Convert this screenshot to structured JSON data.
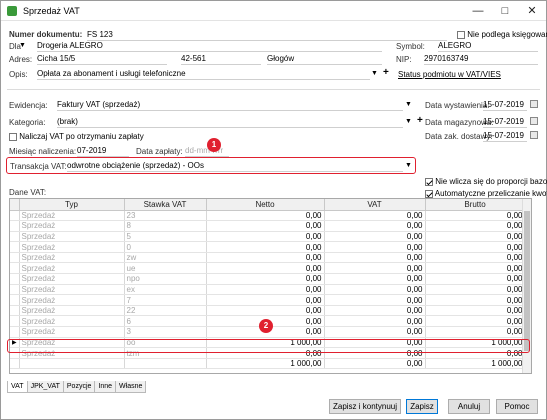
{
  "window": {
    "title": "Sprzedaż VAT"
  },
  "doc": {
    "number_label": "Numer dokumentu:",
    "number": "FS 123",
    "not_posted_label": "Nie podlega księgowaniu",
    "dla_label": "Dla",
    "customer": "Drogeria ALEGRO",
    "symbol_label": "Symbol:",
    "symbol": "ALEGRO",
    "address_label": "Adres:",
    "street": "Cicha 15/5",
    "postal": "42-561",
    "city": "Głogów",
    "nip_label": "NIP:",
    "nip": "2970163749",
    "desc_label": "Opis:",
    "desc": "Opłata za abonament i usługi telefoniczne",
    "vat_status_link": "Status podmiotu w VAT/VIES"
  },
  "meta": {
    "ewidencja_label": "Ewidencja:",
    "ewidencja": "Faktury VAT (sprzedaż)",
    "kategoria_label": "Kategoria:",
    "kategoria": "(brak)",
    "naliczaj_label": "Naliczaj VAT po otrzymaniu zapłaty",
    "miesiac_label": "Miesiąc naliczenia:",
    "miesiac": "07-2019",
    "data_zaplaty_label": "Data zapłaty:",
    "data_zaplaty_placeholder": "dd-mm-rrrr",
    "wystawienia_label": "Data wystawienia:",
    "wystawienia": "15-07-2019",
    "magazynowa_label": "Data magazynowa:",
    "magazynowa": "15-07-2019",
    "dostawy_label": "Data zak. dostawy:",
    "dostawy": "15-07-2019",
    "transakcja_label": "Transakcja VAT:",
    "transakcja": "odwrotne obciążenie (sprzedaż) - OOs",
    "dane_vat_label": "Dane VAT:",
    "nie_wlicza_label": "Nie wlicza się do proporcji bazowej",
    "auto_label": "Automatyczne przeliczanie kwot"
  },
  "table": {
    "headers": [
      "Typ",
      "Stawka VAT",
      "Netto",
      "VAT",
      "Brutto"
    ],
    "rows": [
      [
        "Sprzedaż",
        "23",
        "0,00",
        "0,00",
        "0,00"
      ],
      [
        "Sprzedaż",
        "8",
        "0,00",
        "0,00",
        "0,00"
      ],
      [
        "Sprzedaż",
        "5",
        "0,00",
        "0,00",
        "0,00"
      ],
      [
        "Sprzedaż",
        "0",
        "0,00",
        "0,00",
        "0,00"
      ],
      [
        "Sprzedaż",
        "zw",
        "0,00",
        "0,00",
        "0,00"
      ],
      [
        "Sprzedaż",
        "ue",
        "0,00",
        "0,00",
        "0,00"
      ],
      [
        "Sprzedaż",
        "npo",
        "0,00",
        "0,00",
        "0,00"
      ],
      [
        "Sprzedaż",
        "ex",
        "0,00",
        "0,00",
        "0,00"
      ],
      [
        "Sprzedaż",
        "7",
        "0,00",
        "0,00",
        "0,00"
      ],
      [
        "Sprzedaż",
        "22",
        "0,00",
        "0,00",
        "0,00"
      ],
      [
        "Sprzedaż",
        "6",
        "0,00",
        "0,00",
        "0,00"
      ],
      [
        "Sprzedaż",
        "3",
        "0,00",
        "0,00",
        "0,00"
      ],
      [
        "Sprzedaż",
        "oo",
        "1 000,00",
        "0,00",
        "1 000,00"
      ],
      [
        "Sprzedaż",
        "tzm",
        "0,00",
        "0,00",
        "0,00"
      ]
    ],
    "totals": [
      "",
      "",
      "1 000,00",
      "0,00",
      "1 000,00"
    ],
    "selected_row": 12
  },
  "tabs": [
    "VAT",
    "JPK_VAT",
    "Pozycje",
    "Inne",
    "Własne"
  ],
  "buttons": {
    "save_continue": "Zapisz i kontynuuj",
    "save": "Zapisz",
    "cancel": "Anuluj",
    "help": "Pomoc"
  },
  "badges": {
    "b1": "1",
    "b2": "2"
  },
  "colors": {
    "highlight": "#e0202f",
    "dim_text": "#a8a8a8"
  }
}
